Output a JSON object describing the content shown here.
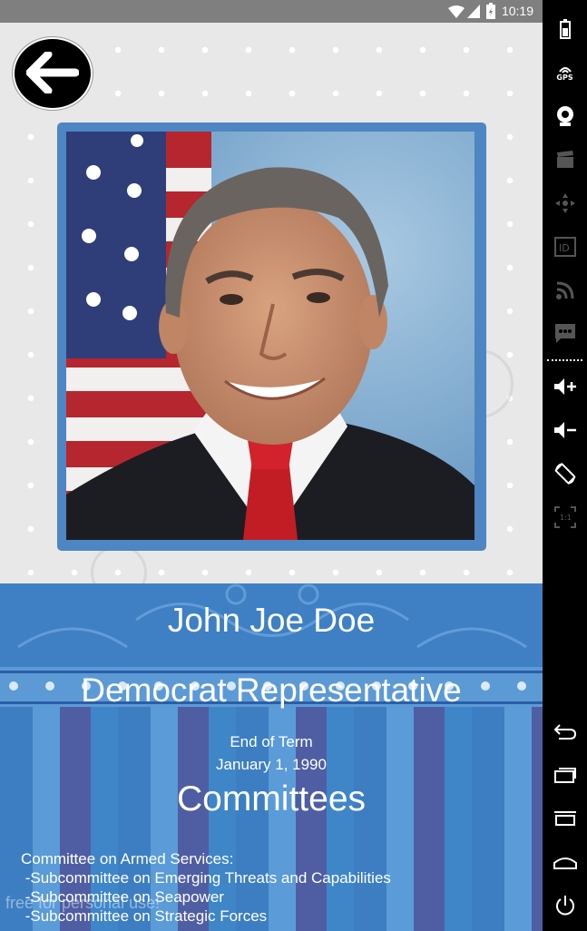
{
  "status_bar": {
    "time": "10:19"
  },
  "profile": {
    "name": "John Joe Doe",
    "role": "Democrat Representative",
    "term_label": "End of Term",
    "term_date": "January 1, 1990"
  },
  "committees": {
    "title": "Committees",
    "items": [
      "Committee on Armed Services:",
      " -Subcommittee on Emerging Threats and Capabilities",
      " -Subcommittee on Seapower",
      " -Subcommittee on Strategic Forces"
    ]
  },
  "watermark": "free for personal use!",
  "side_toolbar": {
    "gps_label": "GPS",
    "scale_label": "1:1"
  },
  "icons": [
    "back-arrow-icon",
    "battery-icon",
    "gps-icon",
    "camera-icon",
    "clapper-icon",
    "dpad-icon",
    "id-icon",
    "rss-icon",
    "sms-icon",
    "volume-up-icon",
    "volume-down-icon",
    "rotate-icon",
    "scale-icon",
    "nav-back-icon",
    "recents-icon",
    "menu-icon",
    "home-icon",
    "power-icon",
    "wifi-icon",
    "signal-icon"
  ],
  "colors": {
    "accent_blue": "#4d86c3",
    "status_bar": "#7f7f7f",
    "panel_blue": "#3f80c4"
  }
}
